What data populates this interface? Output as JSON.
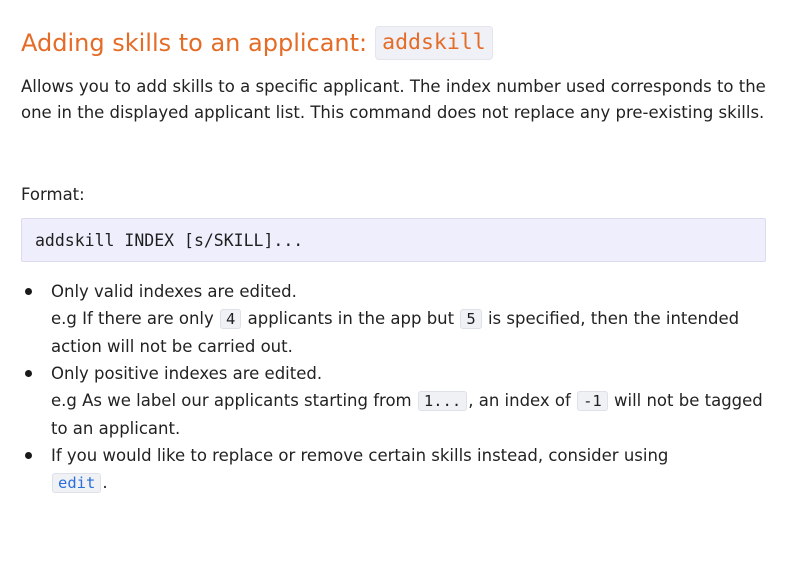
{
  "heading": {
    "title": "Adding skills to an applicant:",
    "command": "addskill"
  },
  "intro": "Allows you to add skills to a specific applicant. The index number used corresponds to the one in the displayed applicant list. This command does not replace any pre-existing skills.",
  "format": {
    "label": "Format:",
    "code": "addskill INDEX [s/SKILL]..."
  },
  "bullets": [
    {
      "main": "Only valid indexes are edited.",
      "ex_prefix": "e.g If there are only",
      "code1": "4",
      "ex_mid": "applicants in the app but",
      "code2": "5",
      "ex_suffix": "is specified, then the intended action will not be carried out."
    },
    {
      "main": "Only positive indexes are edited.",
      "ex_prefix": "e.g As we label our applicants starting from",
      "code1": "1...",
      "ex_mid": ", an index of",
      "code2": "-1",
      "ex_suffix": "will not be tagged to an applicant."
    },
    {
      "main": "If you would like to replace or remove certain skills instead, consider using",
      "code1": "edit",
      "ex_suffix": "."
    }
  ],
  "colors": {
    "heading": "#e46c27",
    "link": "#2a6fdb",
    "format_bg": "#eeeefc"
  }
}
